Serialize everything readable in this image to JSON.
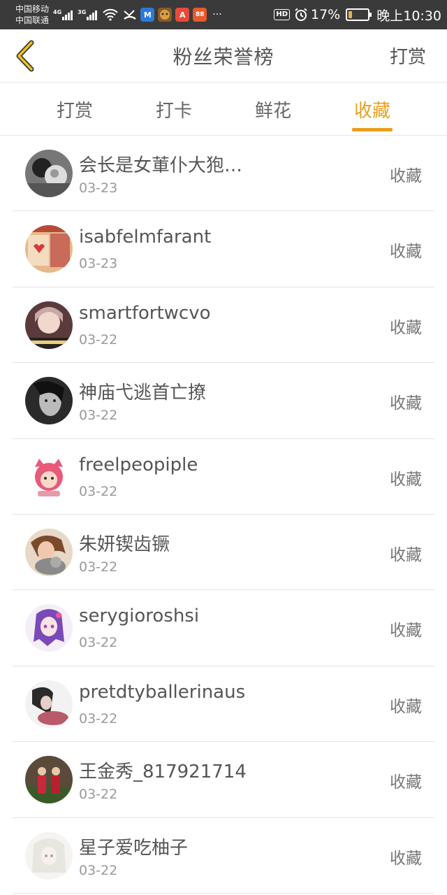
{
  "status_bar": {
    "carrier1": "中国移动",
    "carrier2": "中国联通",
    "sig1_tag": "4G",
    "sig2_tag": "3G",
    "hd": "HD",
    "battery_pct": "17%",
    "battery_level": 0.17,
    "time": "晚上10:30",
    "apps": [
      {
        "icon": "meituan-app-icon",
        "label": "M",
        "color": "#2a7bd8"
      },
      {
        "icon": "game-app-icon",
        "label": "",
        "color": "#8a5a2a"
      },
      {
        "icon": "a-app-icon",
        "label": "A",
        "color": "#e84a3a"
      },
      {
        "icon": "grid-app-icon",
        "label": "88",
        "color": "#e85a2a"
      }
    ],
    "more": "···"
  },
  "header": {
    "title": "粉丝荣誉榜",
    "action": "打赏"
  },
  "tabs": [
    {
      "label": "打赏",
      "active": false
    },
    {
      "label": "打卡",
      "active": false
    },
    {
      "label": "鲜花",
      "active": false
    },
    {
      "label": "收藏",
      "active": true
    }
  ],
  "accent_color": "#e8a020",
  "list": [
    {
      "name": "会长是女莗仆大狍…",
      "date": "03-23",
      "action": "收藏",
      "avatar": "avatar-bw-person"
    },
    {
      "name": "isabfelmfarant",
      "date": "03-23",
      "action": "收藏",
      "avatar": "avatar-heart"
    },
    {
      "name": "smartfortwcvo",
      "date": "03-22",
      "action": "收藏",
      "avatar": "avatar-girl"
    },
    {
      "name": "神庙弋逃首亡撩",
      "date": "03-22",
      "action": "收藏",
      "avatar": "avatar-bw-face"
    },
    {
      "name": "freelpeopiple",
      "date": "03-22",
      "action": "收藏",
      "avatar": "avatar-cartoon"
    },
    {
      "name": "朱妍锲齿镢",
      "date": "03-22",
      "action": "收藏",
      "avatar": "avatar-cat"
    },
    {
      "name": "serygioroshsi",
      "date": "03-22",
      "action": "收藏",
      "avatar": "avatar-anime"
    },
    {
      "name": "pretdtyballerinaus",
      "date": "03-22",
      "action": "收藏",
      "avatar": "avatar-sketch"
    },
    {
      "name": "王金秀_817921714",
      "date": "03-22",
      "action": "收藏",
      "avatar": "avatar-couple"
    },
    {
      "name": "星子爱吃柚子",
      "date": "03-22",
      "action": "收藏",
      "avatar": "avatar-white-hair"
    }
  ]
}
